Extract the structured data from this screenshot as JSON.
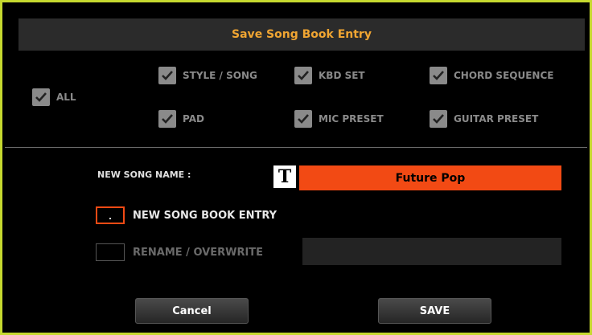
{
  "dialog": {
    "title": "Save Song Book Entry"
  },
  "checkboxes": {
    "all": {
      "label": "ALL",
      "checked": true
    },
    "style_song": {
      "label": "STYLE / SONG",
      "checked": true
    },
    "kbd_set": {
      "label": "KBD SET",
      "checked": true
    },
    "chord_sequence": {
      "label": "CHORD SEQUENCE",
      "checked": true
    },
    "pad": {
      "label": "PAD",
      "checked": true
    },
    "mic_preset": {
      "label": "MIC PRESET",
      "checked": true
    },
    "guitar_preset": {
      "label": "GUITAR PRESET",
      "checked": true
    }
  },
  "name": {
    "label": "NEW SONG NAME :",
    "text_icon": "T",
    "value": "Future Pop"
  },
  "options": {
    "new_entry": {
      "label": "NEW SONG BOOK ENTRY",
      "selected": true
    },
    "rename": {
      "label": "RENAME / OVERWRITE",
      "selected": false
    }
  },
  "buttons": {
    "cancel": "Cancel",
    "save": "SAVE"
  },
  "colors": {
    "frame": "#c6d92f",
    "title_text": "#f0a532",
    "accent": "#f24a14"
  }
}
